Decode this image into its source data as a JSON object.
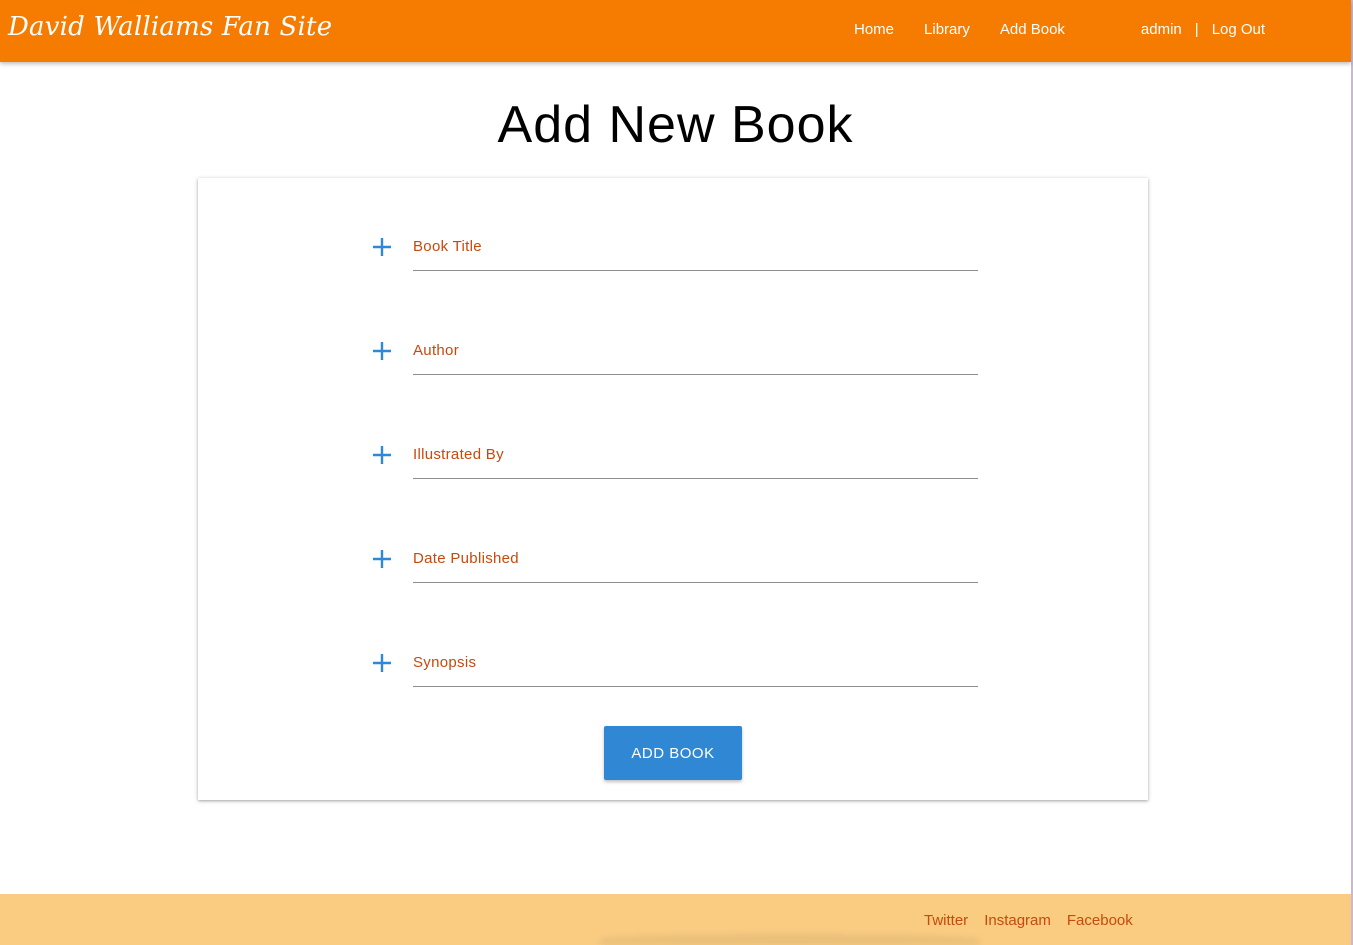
{
  "header": {
    "brand": "David Walliams Fan Site",
    "nav": {
      "home": "Home",
      "library": "Library",
      "add_book": "Add Book"
    },
    "user": "admin",
    "separator": "|",
    "logout": "Log Out"
  },
  "main": {
    "title": "Add New Book",
    "fields": [
      {
        "label": "Book Title",
        "icon": "plus-icon"
      },
      {
        "label": "Author",
        "icon": "plus-icon"
      },
      {
        "label": "Illustrated By",
        "icon": "plus-icon"
      },
      {
        "label": "Date Published",
        "icon": "plus-icon"
      },
      {
        "label": "Synopsis",
        "icon": "plus-icon"
      }
    ],
    "submit_label": "ADD BOOK"
  },
  "footer": {
    "links": [
      "Twitter",
      "Instagram",
      "Facebook"
    ]
  },
  "colors": {
    "header_bg": "#f57c00",
    "footer_bg": "#f9cc82",
    "label": "#c8490c",
    "accent": "#3088d4"
  }
}
